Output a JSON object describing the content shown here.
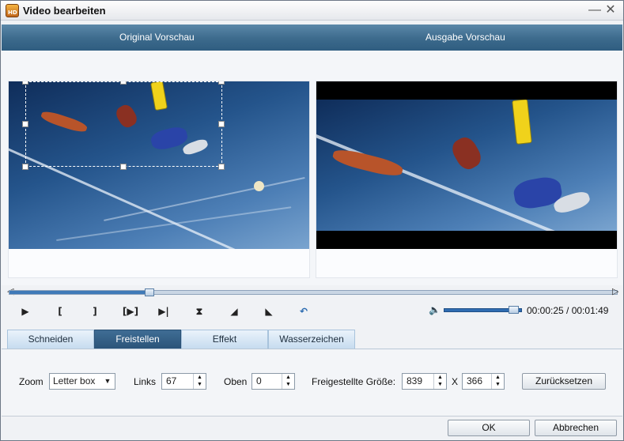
{
  "window": {
    "title": "Video bearbeiten",
    "minimize_glyph": "—",
    "close_glyph": "✕",
    "app_icon_text": "HD"
  },
  "preview": {
    "original_label": "Original Vorschau",
    "output_label": "Ausgabe Vorschau"
  },
  "timeline": {
    "progress": 0.23
  },
  "controls": {
    "play": "▶",
    "mark_in": "[",
    "mark_out": "]",
    "play_segment": "[▶]",
    "skip_next": "▶|",
    "flip_vertical": "⧗",
    "flip_left": "◢",
    "flip_right": "◣",
    "undo": "↶"
  },
  "volume": {
    "level": 0.9
  },
  "timecode": "00:00:25 / 00:01:49",
  "tabs": [
    {
      "label": "Schneiden"
    },
    {
      "label": "Freistellen"
    },
    {
      "label": "Effekt"
    },
    {
      "label": "Wasserzeichen"
    }
  ],
  "active_tab": "Freistellen",
  "crop": {
    "zoom_label": "Zoom",
    "zoom_value": "Letter box",
    "left_label": "Links",
    "left_value": "67",
    "top_label": "Oben",
    "top_value": "0",
    "size_label": "Freigestellte Größe:",
    "width_value": "839",
    "size_separator": "X",
    "height_value": "366",
    "reset_label": "Zurücksetzen"
  },
  "footer": {
    "ok_label": "OK",
    "cancel_label": "Abbrechen"
  },
  "colors": {
    "header_bar": "#3c6a8c",
    "active_tab": "#2b5479",
    "timeline_fill": "#3f7ab8"
  }
}
